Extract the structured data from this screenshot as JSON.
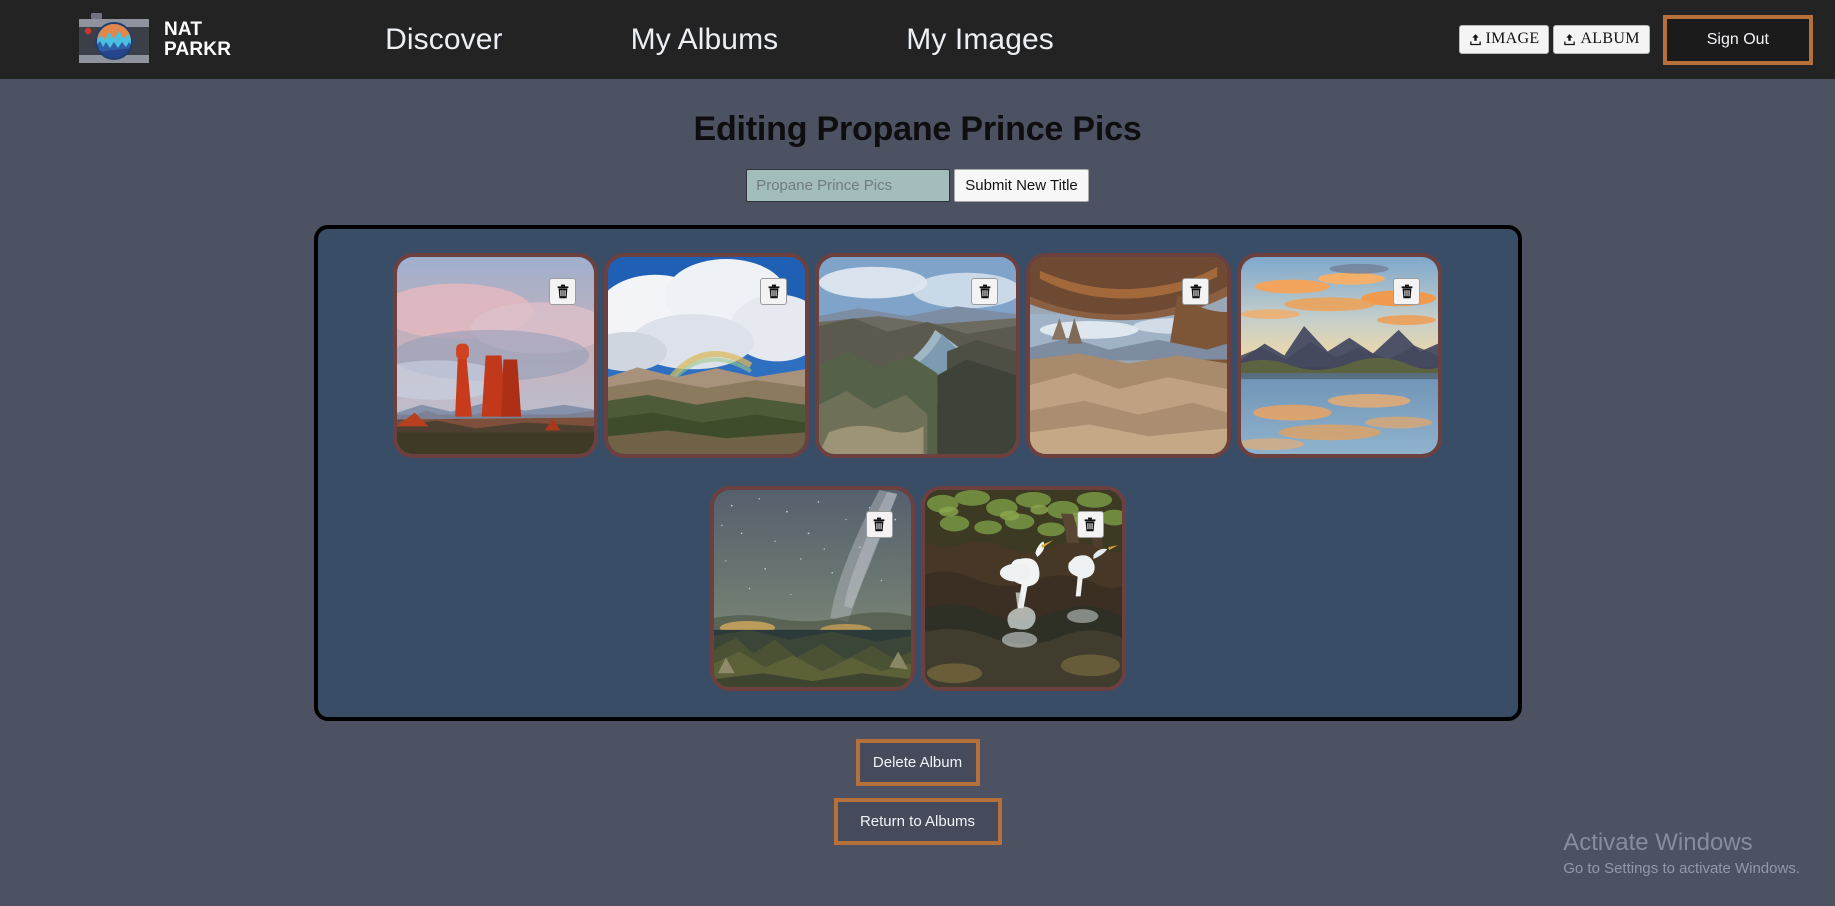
{
  "header": {
    "brand": {
      "name": "NAT\nPARKR",
      "logo_icon": "camera-icon"
    },
    "nav": [
      {
        "label": "Discover",
        "name": "nav-link-discover"
      },
      {
        "label": "My Albums",
        "name": "nav-link-my-albums"
      },
      {
        "label": "My Images",
        "name": "nav-link-my-images"
      }
    ],
    "upload_image_label": "IMAGE",
    "upload_album_label": "ALBUM",
    "upload_icon": "upload-icon",
    "sign_out_label": "Sign Out"
  },
  "main": {
    "page_title": "Editing Propane Prince Pics",
    "title_input_placeholder": "Propane Prince Pics",
    "title_input_value": "",
    "submit_label": "Submit New Title",
    "delete_album_label": "Delete Album",
    "return_to_albums_label": "Return to Albums",
    "delete_icon": "trash-icon"
  },
  "photos": {
    "row1": [
      {
        "alt": "Red rock spires under pink storm clouds"
      },
      {
        "alt": "Rainbow over desert hills with cumulus clouds"
      },
      {
        "alt": "River winding through a desert canyon"
      },
      {
        "alt": "View through a rock arch over canyon country"
      },
      {
        "alt": "Sunset clouds reflected in a mountain lake"
      }
    ],
    "row2": [
      {
        "alt": "Milky Way over a canyon at night"
      },
      {
        "alt": "White egrets wading in a swamp"
      }
    ]
  },
  "colors": {
    "page_background": "#4d5263",
    "header_background": "#232323",
    "album_background": "#3a4d67",
    "album_border": "#000000",
    "card_border": "#6d4040",
    "accent_orange": "#b5703c",
    "input_background": "#a3bcbc"
  },
  "watermark": {
    "title": "Activate Windows",
    "subtitle": "Go to Settings to activate Windows."
  }
}
